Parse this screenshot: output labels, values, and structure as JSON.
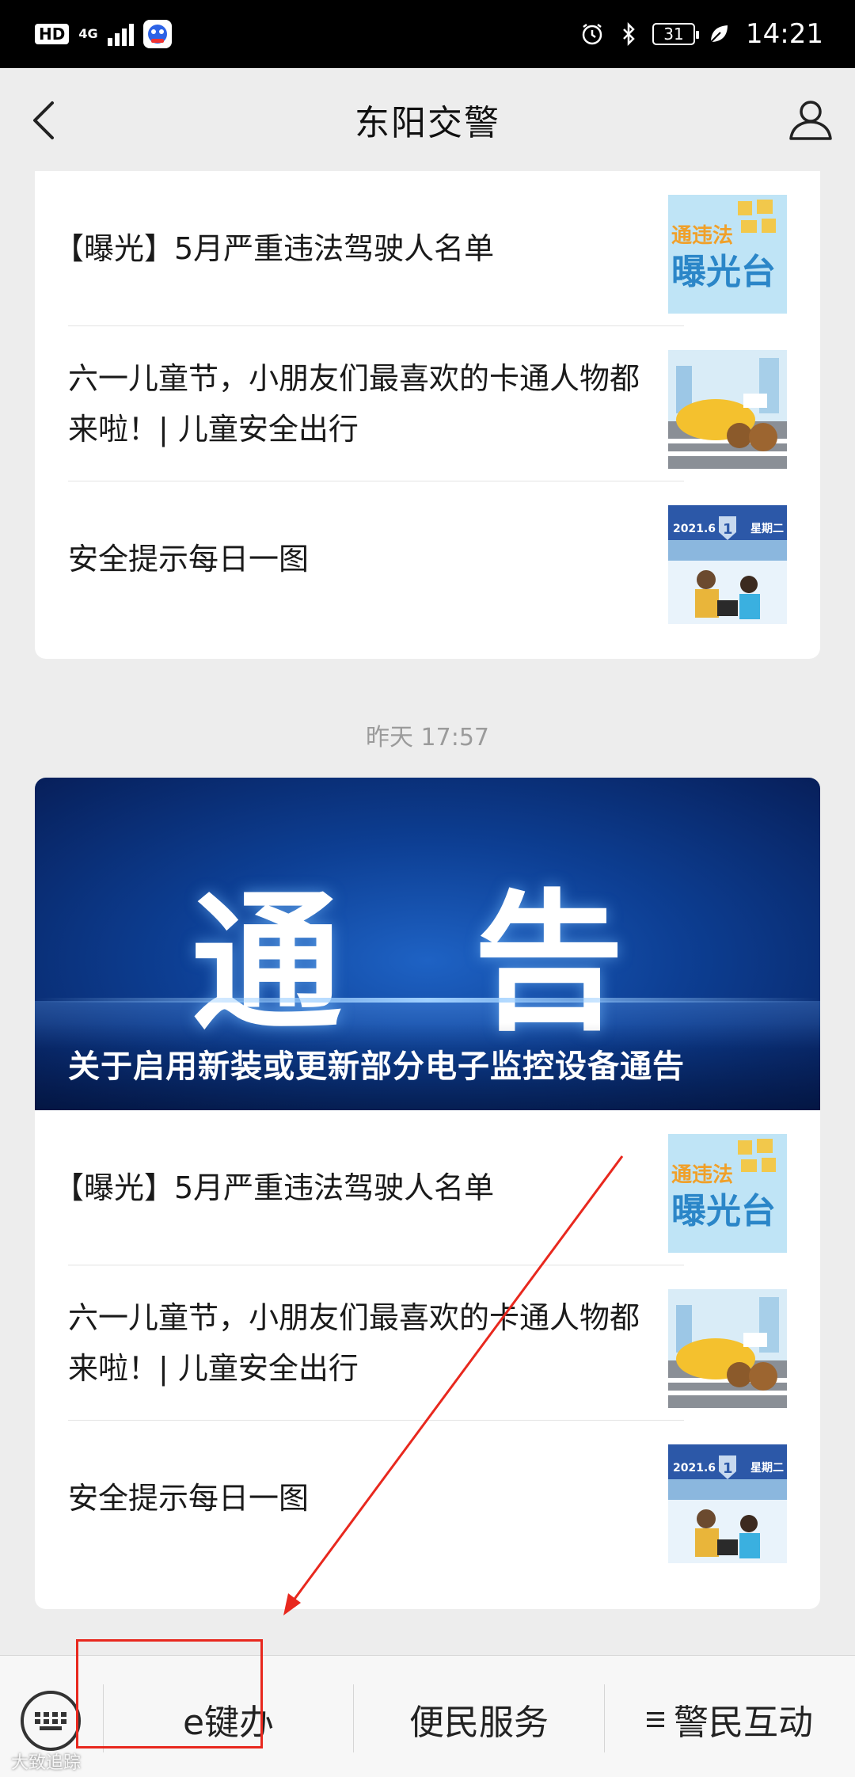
{
  "status_bar": {
    "hd": "HD",
    "network": "4G",
    "battery": "31",
    "time": "14:21"
  },
  "header": {
    "title": "东阳交警",
    "back_icon": "chevron-left-icon",
    "profile_icon": "person-icon"
  },
  "feed": {
    "first_group": {
      "articles": [
        {
          "title": "【曝光】5月严重违法驾驶人名单",
          "thumb": "exposure-thumbnail"
        },
        {
          "title": "六一儿童节，小朋友们最喜欢的卡通人物都来啦！| 儿童安全出行",
          "thumb": "cartoon-thumbnail"
        },
        {
          "title": "安全提示每日一图",
          "thumb": "daily-safety-thumbnail"
        }
      ]
    },
    "timestamp": "昨天 17:57",
    "second_group": {
      "banner_word": "通 告",
      "banner_caption": "关于启用新装或更新部分电子监控设备通告",
      "articles": [
        {
          "title": "【曝光】5月严重违法驾驶人名单",
          "thumb": "exposure-thumbnail"
        },
        {
          "title": "六一儿童节，小朋友们最喜欢的卡通人物都来啦！| 儿童安全出行",
          "thumb": "cartoon-thumbnail"
        },
        {
          "title": "安全提示每日一图",
          "thumb": "daily-safety-thumbnail"
        }
      ]
    }
  },
  "thumb_text": {
    "exposure_top": "通违法",
    "exposure_bottom": "曝光台",
    "date_label": "2021.6",
    "day_label": "星期二",
    "day_number": "1"
  },
  "bottom_menu": {
    "keyboard_icon": "keyboard-icon",
    "items": [
      {
        "label": "e键办"
      },
      {
        "label": "便民服务"
      },
      {
        "label": "警民互动"
      }
    ]
  },
  "watermark": "大致追踪",
  "colors": {
    "background": "#ededed",
    "card": "#ffffff",
    "annotation_red": "#e8281e",
    "banner_blue": "#0d3f94"
  }
}
